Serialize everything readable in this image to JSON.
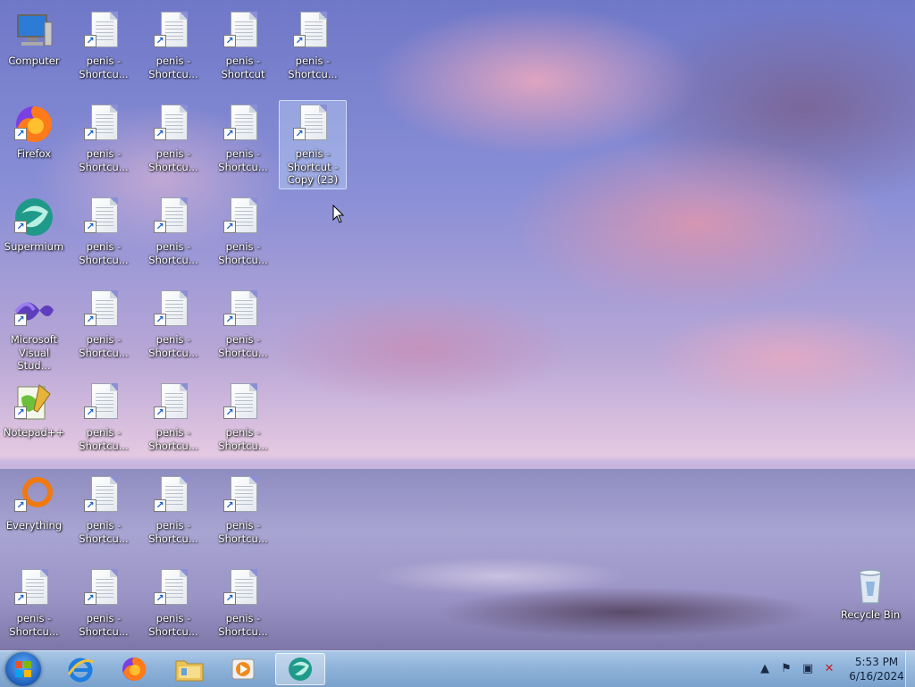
{
  "desktop": {
    "icons": [
      {
        "id": "computer",
        "label": "Computer",
        "type": "computer",
        "col": 0,
        "row": 0
      },
      {
        "id": "firefox",
        "label": "Firefox",
        "type": "firefox",
        "col": 0,
        "row": 1
      },
      {
        "id": "supermium",
        "label": "Supermium",
        "type": "supermium",
        "col": 0,
        "row": 2
      },
      {
        "id": "vs",
        "label": "Microsoft\nVisual Stud...",
        "type": "vs",
        "col": 0,
        "row": 3
      },
      {
        "id": "notepadpp",
        "label": "Notepad++",
        "type": "notepad",
        "col": 0,
        "row": 4
      },
      {
        "id": "everything",
        "label": "Everything",
        "type": "everything",
        "col": 0,
        "row": 5
      },
      {
        "id": "s-0-6",
        "label": "penis -\nShortcu...",
        "type": "doc",
        "col": 0,
        "row": 6
      },
      {
        "id": "s-1-0",
        "label": "penis -\nShortcu...",
        "type": "doc",
        "col": 1,
        "row": 0
      },
      {
        "id": "s-1-1",
        "label": "penis -\nShortcu...",
        "type": "doc",
        "col": 1,
        "row": 1
      },
      {
        "id": "s-1-2",
        "label": "penis -\nShortcu...",
        "type": "doc",
        "col": 1,
        "row": 2
      },
      {
        "id": "s-1-3",
        "label": "penis -\nShortcu...",
        "type": "doc",
        "col": 1,
        "row": 3
      },
      {
        "id": "s-1-4",
        "label": "penis -\nShortcu...",
        "type": "doc",
        "col": 1,
        "row": 4
      },
      {
        "id": "s-1-5",
        "label": "penis -\nShortcu...",
        "type": "doc",
        "col": 1,
        "row": 5
      },
      {
        "id": "s-1-6",
        "label": "penis -\nShortcu...",
        "type": "doc",
        "col": 1,
        "row": 6
      },
      {
        "id": "s-2-0",
        "label": "penis -\nShortcu...",
        "type": "doc",
        "col": 2,
        "row": 0
      },
      {
        "id": "s-2-1",
        "label": "penis -\nShortcu...",
        "type": "doc",
        "col": 2,
        "row": 1
      },
      {
        "id": "s-2-2",
        "label": "penis -\nShortcu...",
        "type": "doc",
        "col": 2,
        "row": 2
      },
      {
        "id": "s-2-3",
        "label": "penis -\nShortcu...",
        "type": "doc",
        "col": 2,
        "row": 3
      },
      {
        "id": "s-2-4",
        "label": "penis -\nShortcu...",
        "type": "doc",
        "col": 2,
        "row": 4
      },
      {
        "id": "s-2-5",
        "label": "penis -\nShortcu...",
        "type": "doc",
        "col": 2,
        "row": 5
      },
      {
        "id": "s-2-6",
        "label": "penis -\nShortcu...",
        "type": "doc",
        "col": 2,
        "row": 6
      },
      {
        "id": "s-3-0",
        "label": "penis -\nShortcut",
        "type": "doc",
        "col": 3,
        "row": 0
      },
      {
        "id": "s-3-1",
        "label": "penis -\nShortcu...",
        "type": "doc",
        "col": 3,
        "row": 1
      },
      {
        "id": "s-3-2",
        "label": "penis -\nShortcu...",
        "type": "doc",
        "col": 3,
        "row": 2
      },
      {
        "id": "s-3-3",
        "label": "penis -\nShortcu...",
        "type": "doc",
        "col": 3,
        "row": 3
      },
      {
        "id": "s-3-4",
        "label": "penis -\nShortcu...",
        "type": "doc",
        "col": 3,
        "row": 4
      },
      {
        "id": "s-3-5",
        "label": "penis -\nShortcu...",
        "type": "doc",
        "col": 3,
        "row": 5
      },
      {
        "id": "s-3-6",
        "label": "penis -\nShortcu...",
        "type": "doc",
        "col": 3,
        "row": 6
      },
      {
        "id": "s-4-0",
        "label": "penis -\nShortcu...",
        "type": "doc",
        "col": 4,
        "row": 0
      },
      {
        "id": "s-4-1",
        "label": "penis -\nShortcut -\nCopy (23)",
        "type": "doc",
        "col": 4,
        "row": 1,
        "selected": true
      }
    ],
    "recycle_bin": {
      "label": "Recycle Bin"
    }
  },
  "taskbar": {
    "pinned": [
      {
        "id": "ie",
        "icon": "internet-explorer-icon"
      },
      {
        "id": "firefox",
        "icon": "firefox-icon"
      },
      {
        "id": "explorer",
        "icon": "folder-icon"
      },
      {
        "id": "media",
        "icon": "media-player-icon"
      },
      {
        "id": "supermium",
        "icon": "supermium-icon",
        "active": true
      }
    ],
    "clock": {
      "time": "5:53 PM",
      "date": "6/16/2024"
    }
  },
  "colors": {
    "accent": "#1f5eb8",
    "taskbar": "#8fb3da"
  }
}
